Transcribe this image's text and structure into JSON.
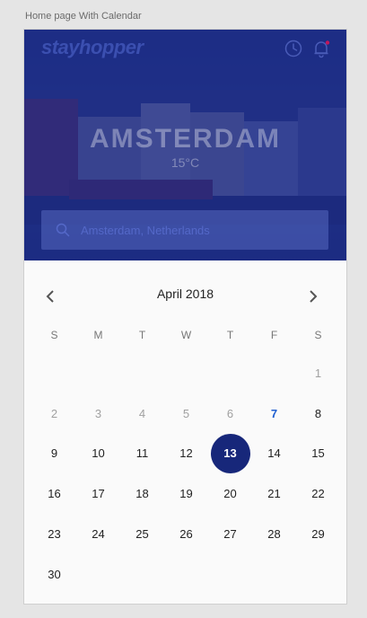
{
  "artboard_label": "Home page With Calendar",
  "header": {
    "logo_text": "stayhopper",
    "icons": [
      "clock-icon",
      "bell-icon"
    ],
    "brand_color": "#3b4fb0"
  },
  "hero": {
    "city": "AMSTERDAM",
    "temperature": "15°C",
    "overlay_color": "#18288c"
  },
  "search": {
    "value": "Amsterdam, Netherlands",
    "icon": "search-icon"
  },
  "calendar": {
    "month_label": "April 2018",
    "weekdays": [
      "S",
      "M",
      "T",
      "W",
      "T",
      "F",
      "S"
    ],
    "days": [
      {
        "label": "",
        "state": "blank"
      },
      {
        "label": "",
        "state": "blank"
      },
      {
        "label": "",
        "state": "blank"
      },
      {
        "label": "",
        "state": "blank"
      },
      {
        "label": "",
        "state": "blank"
      },
      {
        "label": "",
        "state": "blank"
      },
      {
        "label": "1",
        "state": "muted"
      },
      {
        "label": "2",
        "state": "muted"
      },
      {
        "label": "3",
        "state": "muted"
      },
      {
        "label": "4",
        "state": "muted"
      },
      {
        "label": "5",
        "state": "muted"
      },
      {
        "label": "6",
        "state": "muted"
      },
      {
        "label": "7",
        "state": "today"
      },
      {
        "label": "8",
        "state": "normal"
      },
      {
        "label": "9",
        "state": "normal"
      },
      {
        "label": "10",
        "state": "normal"
      },
      {
        "label": "11",
        "state": "normal"
      },
      {
        "label": "12",
        "state": "normal"
      },
      {
        "label": "13",
        "state": "selected"
      },
      {
        "label": "14",
        "state": "normal"
      },
      {
        "label": "15",
        "state": "normal"
      },
      {
        "label": "16",
        "state": "normal"
      },
      {
        "label": "17",
        "state": "normal"
      },
      {
        "label": "18",
        "state": "normal"
      },
      {
        "label": "19",
        "state": "normal"
      },
      {
        "label": "20",
        "state": "normal"
      },
      {
        "label": "21",
        "state": "normal"
      },
      {
        "label": "22",
        "state": "normal"
      },
      {
        "label": "23",
        "state": "normal"
      },
      {
        "label": "24",
        "state": "normal"
      },
      {
        "label": "25",
        "state": "normal"
      },
      {
        "label": "26",
        "state": "normal"
      },
      {
        "label": "27",
        "state": "normal"
      },
      {
        "label": "28",
        "state": "normal"
      },
      {
        "label": "29",
        "state": "normal"
      },
      {
        "label": "30",
        "state": "normal"
      }
    ],
    "selected_color": "#17277a",
    "today_color": "#1f5fd0",
    "nav_icons": [
      "chevron-left-icon",
      "chevron-right-icon"
    ]
  }
}
